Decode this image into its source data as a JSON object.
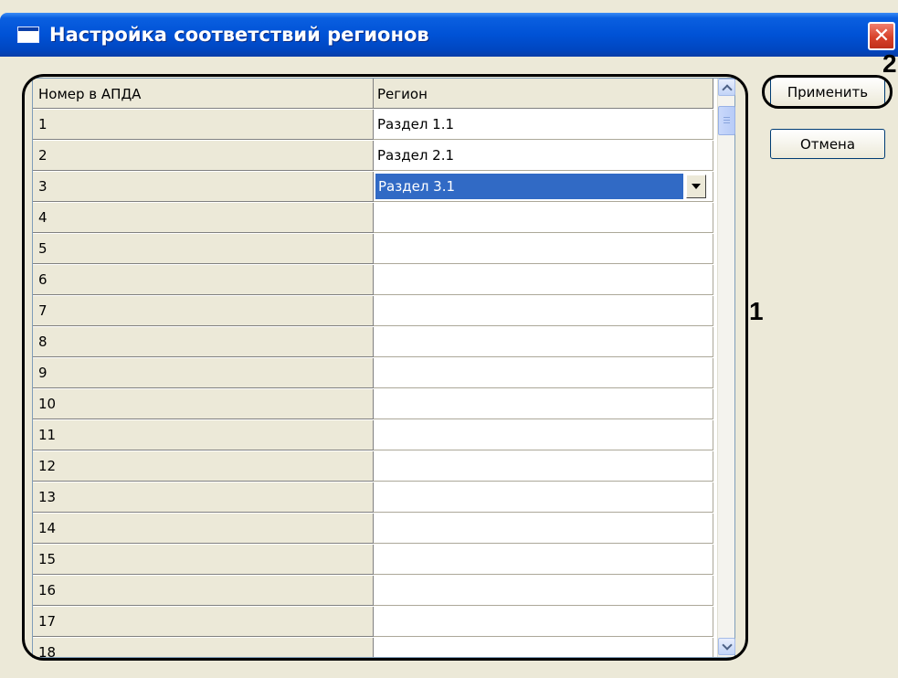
{
  "window": {
    "title": "Настройка соответствий регионов",
    "close_glyph": "✕"
  },
  "grid": {
    "columns": [
      "Номер в АПДА",
      "Регион"
    ],
    "rows": [
      {
        "num": "1",
        "region": "Раздел 1.1"
      },
      {
        "num": "2",
        "region": "Раздел 2.1"
      },
      {
        "num": "3",
        "region": "Раздел 3.1",
        "selected": true
      },
      {
        "num": "4",
        "region": ""
      },
      {
        "num": "5",
        "region": ""
      },
      {
        "num": "6",
        "region": ""
      },
      {
        "num": "7",
        "region": ""
      },
      {
        "num": "8",
        "region": ""
      },
      {
        "num": "9",
        "region": ""
      },
      {
        "num": "10",
        "region": ""
      },
      {
        "num": "11",
        "region": ""
      },
      {
        "num": "12",
        "region": ""
      },
      {
        "num": "13",
        "region": ""
      },
      {
        "num": "14",
        "region": ""
      },
      {
        "num": "15",
        "region": ""
      },
      {
        "num": "16",
        "region": ""
      },
      {
        "num": "17",
        "region": ""
      },
      {
        "num": "18",
        "region": ""
      }
    ]
  },
  "buttons": {
    "apply": "Применить",
    "cancel": "Отмена"
  },
  "callouts": {
    "grid": "1",
    "apply": "2"
  },
  "colors": {
    "titlebar": "#0052d6",
    "selection": "#316ac5",
    "close": "#d8422a",
    "dialog_bg": "#ece9d8"
  },
  "icons": {
    "window": "window-icon",
    "close": "close-icon",
    "dropdown": "chevron-down-icon",
    "scroll_up": "chevron-up-icon",
    "scroll_down": "chevron-down-icon"
  }
}
